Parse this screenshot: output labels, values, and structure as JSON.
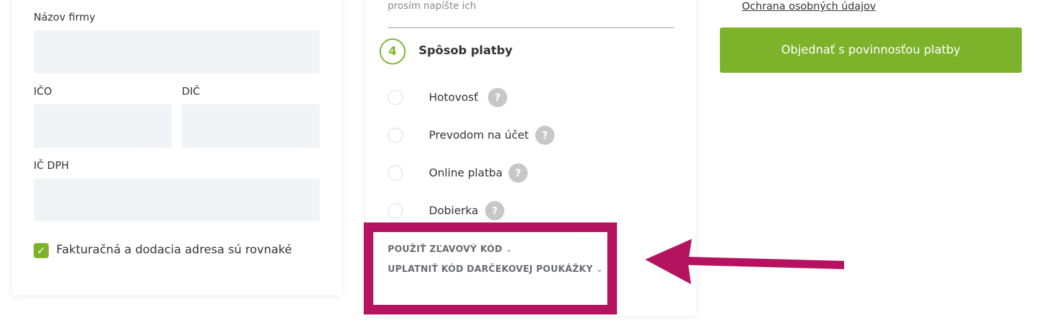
{
  "company_form": {
    "company_name_label": "Názov firmy",
    "ico_label": "IČO",
    "dic_label": "DIČ",
    "ic_dph_label": "IČ DPH",
    "same_address_label": "Fakturačná a dodacia adresa sú rovnaké",
    "same_address_checked": true
  },
  "notes": {
    "hint_text": "prosím napíšte ich"
  },
  "payment": {
    "step_number": "4",
    "title": "Spôsob platby",
    "options": [
      {
        "label": "Hotovosť"
      },
      {
        "label": "Prevodom na účet"
      },
      {
        "label": "Online platba"
      },
      {
        "label": "Dobierka"
      }
    ],
    "help_symbol": "?"
  },
  "discount": {
    "apply_discount_label": "POUŽIŤ ZĽAVOVÝ KÓD",
    "gift_voucher_label": "UPLATNIŤ KÓD DARČEKOVEJ POUKÁŽKY"
  },
  "summary": {
    "privacy_link": "Ochrana osobných údajov",
    "order_button": "Objednať s povinnosťou platby"
  },
  "annotation": {
    "color": "#b5135f"
  },
  "colors": {
    "accent": "#7cb32b",
    "field_bg": "#f1f3f6"
  }
}
